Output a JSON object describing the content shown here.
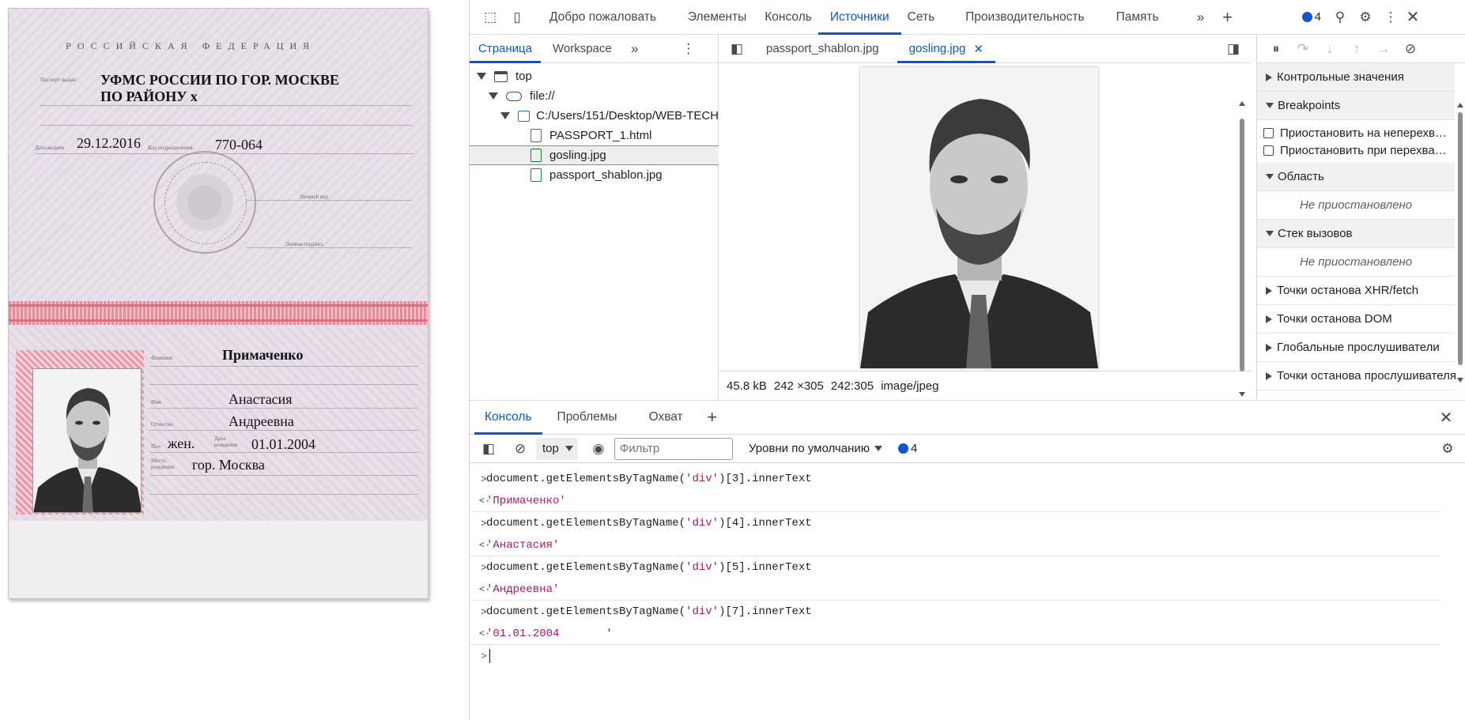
{
  "passport": {
    "country": "РОССИЙСКАЯ ФЕДЕРАЦИЯ",
    "field_issued_by": "Паспорт выдан",
    "issued_by_line1": "УФМС РОССИИ ПО ГОР. МОСКВЕ",
    "issued_by_line2": "ПО РАЙОНУ x",
    "field_issue_date": "Дата выдачи",
    "issue_date": "29.12.2016",
    "field_division_code": "Код подразделения",
    "division_code": "770-064",
    "field_personal_signature": "Личный код",
    "field_signature": "Личная подпись",
    "field_surname": "Фамилия",
    "surname": "Примаченко",
    "field_name": "Имя",
    "name": "Анастасия",
    "field_patronymic": "Отчество",
    "patronymic": "Андреевна",
    "field_sex": "Пол",
    "sex": "жен.",
    "field_birth_date": "Дата рождения",
    "birth_date": "01.01.2004",
    "field_birth_place": "Место рождения",
    "birth_place": "гор. Москва"
  },
  "devtools": {
    "main_tabs": [
      "Добро пожаловать",
      "Элементы",
      "Консоль",
      "Источники",
      "Сеть",
      "Производительность",
      "Память"
    ],
    "active_main_tab": "Источники",
    "issues_count": "4",
    "nav_tabs": [
      "Страница",
      "Workspace"
    ],
    "tree": {
      "top": "top",
      "file": "file://",
      "folder": "C:/Users/151/Desktop/WEB-TECH",
      "files": [
        "PASSPORT_1.html",
        "gosling.jpg",
        "passport_shablon.jpg"
      ]
    },
    "editor_tabs": [
      "passport_shablon.jpg",
      "gosling.jpg"
    ],
    "image_info": {
      "size": "45.8 kB",
      "dimensions": "242 ×305",
      "ratio": "242:305",
      "mime": "image/jpeg"
    },
    "debugger": {
      "watch": "Контрольные значения",
      "breakpoints": "Breakpoints",
      "pause_uncaught": "Приостановить на неперехв…",
      "pause_caught": "Приостановить при перехва…",
      "scope": "Область",
      "not_paused_1": "Не приостановлено",
      "call_stack": "Стек вызовов",
      "not_paused_2": "Не приостановлено",
      "xhr_bp": "Точки останова XHR/fetch",
      "dom_bp": "Точки останова DOM",
      "global_listeners": "Глобальные прослушиватели",
      "event_listener_bp": "Точки останова прослушивателя"
    },
    "drawer_tabs": [
      "Консоль",
      "Проблемы",
      "Охват"
    ],
    "console_toolbar": {
      "context": "top",
      "filter_placeholder": "Фильтр",
      "levels": "Уровни по умолчанию",
      "issues": "4"
    },
    "console": [
      {
        "type": "input",
        "pre": "document.getElementsByTagName(",
        "arg": "'div'",
        "post": ")[3].innerText"
      },
      {
        "type": "output",
        "value": "'Примаченко'"
      },
      {
        "type": "input",
        "pre": "document.getElementsByTagName(",
        "arg": "'div'",
        "post": ")[4].innerText"
      },
      {
        "type": "output",
        "value": "'Анастасия'"
      },
      {
        "type": "input",
        "pre": "document.getElementsByTagName(",
        "arg": "'div'",
        "post": ")[5].innerText"
      },
      {
        "type": "output",
        "value": "'Андреевна'"
      },
      {
        "type": "input",
        "pre": "document.getElementsByTagName(",
        "arg": "'div'",
        "post": ")[7].innerText"
      },
      {
        "type": "output",
        "value": "'01.01.2004       '"
      }
    ]
  },
  "colors": {
    "accent": "#0b57d0",
    "string": "#a31a6a",
    "passport_band": "#e48e9b"
  }
}
